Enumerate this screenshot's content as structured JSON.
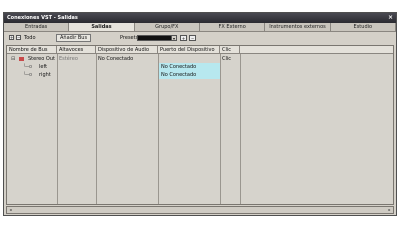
{
  "window": {
    "title": "Conexiones VST - Salidas",
    "close_glyph": "×"
  },
  "tabs": [
    {
      "label": "Entradas",
      "active": false
    },
    {
      "label": "Salidas",
      "active": true
    },
    {
      "label": "Grupo/FX",
      "active": false
    },
    {
      "label": "FX Externo",
      "active": false
    },
    {
      "label": "Instrumentos externos",
      "active": false
    },
    {
      "label": "Estudio",
      "active": false
    }
  ],
  "toolbar": {
    "expand_all_label": "Todo",
    "add_bus_label": "Añadir Bus",
    "preset_label": "Presets",
    "preset_value": ""
  },
  "table": {
    "headers": [
      "Nombre de Bus",
      "Altavoces",
      "Dispositivo de Audio",
      "Puerto del Dispositivo",
      "Clic"
    ],
    "rows": [
      {
        "name": "Stereo Out",
        "speakers": "Estéreo",
        "device": "No Conectado",
        "port": "",
        "click": "Clic"
      },
      {
        "name": "left",
        "speakers": "",
        "device": "",
        "port": "No Conectado",
        "click": ""
      },
      {
        "name": "right",
        "speakers": "",
        "device": "",
        "port": "No Conectado",
        "click": ""
      }
    ]
  },
  "colors": {
    "highlight": "#b7e8ef",
    "titlebar": "#3a3a40"
  }
}
